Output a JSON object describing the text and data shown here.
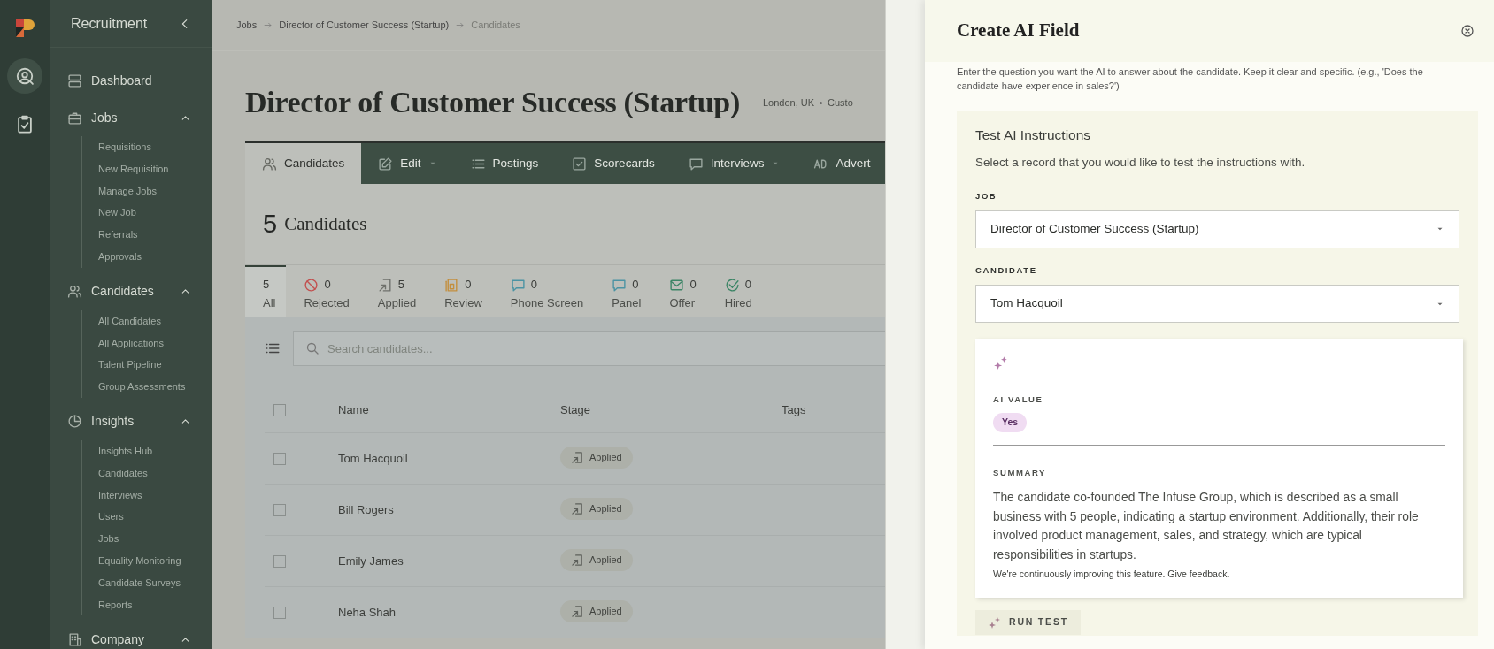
{
  "rail": {
    "items": [
      {
        "kind": "logo"
      },
      {
        "kind": "search-person",
        "selected": true
      },
      {
        "kind": "clipboard",
        "selected": false
      }
    ]
  },
  "sidebar": {
    "title": "Recruitment",
    "items": [
      {
        "label": "Dashboard"
      },
      {
        "label": "Jobs",
        "expanded": true,
        "children": [
          {
            "label": "Requisitions"
          },
          {
            "label": "New Requisition"
          },
          {
            "label": "Manage Jobs"
          },
          {
            "label": "New Job"
          },
          {
            "label": "Referrals"
          },
          {
            "label": "Approvals"
          }
        ]
      },
      {
        "label": "Candidates",
        "expanded": true,
        "children": [
          {
            "label": "All Candidates"
          },
          {
            "label": "All Applications"
          },
          {
            "label": "Talent Pipeline"
          },
          {
            "label": "Group Assessments"
          }
        ]
      },
      {
        "label": "Insights",
        "expanded": true,
        "children": [
          {
            "label": "Insights Hub"
          },
          {
            "label": "Candidates"
          },
          {
            "label": "Interviews"
          },
          {
            "label": "Users"
          },
          {
            "label": "Jobs"
          },
          {
            "label": "Equality Monitoring"
          },
          {
            "label": "Candidate Surveys"
          },
          {
            "label": "Reports"
          }
        ]
      },
      {
        "label": "Company",
        "expanded": true
      }
    ]
  },
  "breadcrumb": [
    "Jobs",
    "Director of Customer Success (Startup)",
    "Candidates"
  ],
  "job": {
    "title": "Director of Customer Success (Startup)",
    "location": "London, UK",
    "meta": "Custo"
  },
  "tabs": [
    {
      "label": "Candidates",
      "selected": true
    },
    {
      "label": "Edit",
      "dropdown": true,
      "selected": false
    },
    {
      "label": "Postings",
      "selected": false
    },
    {
      "label": "Scorecards",
      "selected": false
    },
    {
      "label": "Interviews",
      "dropdown": true,
      "selected": false
    },
    {
      "label": "Advert",
      "selected": false
    }
  ],
  "count": {
    "number": "5",
    "label": "Candidates"
  },
  "stages": [
    {
      "count": "5",
      "label": "All",
      "selected": true
    },
    {
      "count": "0",
      "label": "Rejected",
      "color": "#c2504f",
      "selected": false
    },
    {
      "count": "5",
      "label": "Applied",
      "color": "#6f716c",
      "selected": false
    },
    {
      "count": "0",
      "label": "Review",
      "color": "#c38f3e",
      "selected": false
    },
    {
      "count": "0",
      "label": "Phone Screen",
      "color": "#4b93a3",
      "selected": false
    },
    {
      "count": "0",
      "label": "Panel",
      "color": "#4b93a3",
      "selected": false
    },
    {
      "count": "0",
      "label": "Offer",
      "color": "#3c8566",
      "selected": false
    },
    {
      "count": "0",
      "label": "Hired",
      "color": "#3c8566",
      "selected": false
    }
  ],
  "search": {
    "placeholder": "Search candidates..."
  },
  "table": {
    "all_checked": false,
    "columns": [
      "Name",
      "Stage",
      "Tags"
    ],
    "rows": [
      {
        "name": "Tom Hacquoil",
        "stage": "Applied",
        "checked": false
      },
      {
        "name": "Bill Rogers",
        "stage": "Applied",
        "checked": false
      },
      {
        "name": "Emily James",
        "stage": "Applied",
        "checked": false
      },
      {
        "name": "Neha Shah",
        "stage": "Applied",
        "checked": false
      }
    ]
  },
  "drawer": {
    "title": "Create AI Field",
    "description": "Enter the question you want the AI to answer about the candidate. Keep it clear and specific. (e.g., 'Does the candidate have experience in sales?')",
    "test": {
      "title": "Test AI Instructions",
      "subtitle": "Select a record that you would like to test the instructions with.",
      "fields": [
        {
          "label": "JOB",
          "value": "Director of Customer Success (Startup)"
        },
        {
          "label": "CANDIDATE",
          "value": "Tom Hacquoil"
        }
      ],
      "result": {
        "value_label": "AI VALUE",
        "value": "Yes",
        "summary_label": "SUMMARY",
        "summary": "The candidate co-founded The Infuse Group, which is described as a small business with 5 people, indicating a startup environment. Additionally, their role involved product management, sales, and strategy, which are typical responsibilities in startups.",
        "feedback": "We're continuously improving this feature.",
        "feedback_link": "Give feedback."
      },
      "run_button": "RUN TEST"
    }
  }
}
